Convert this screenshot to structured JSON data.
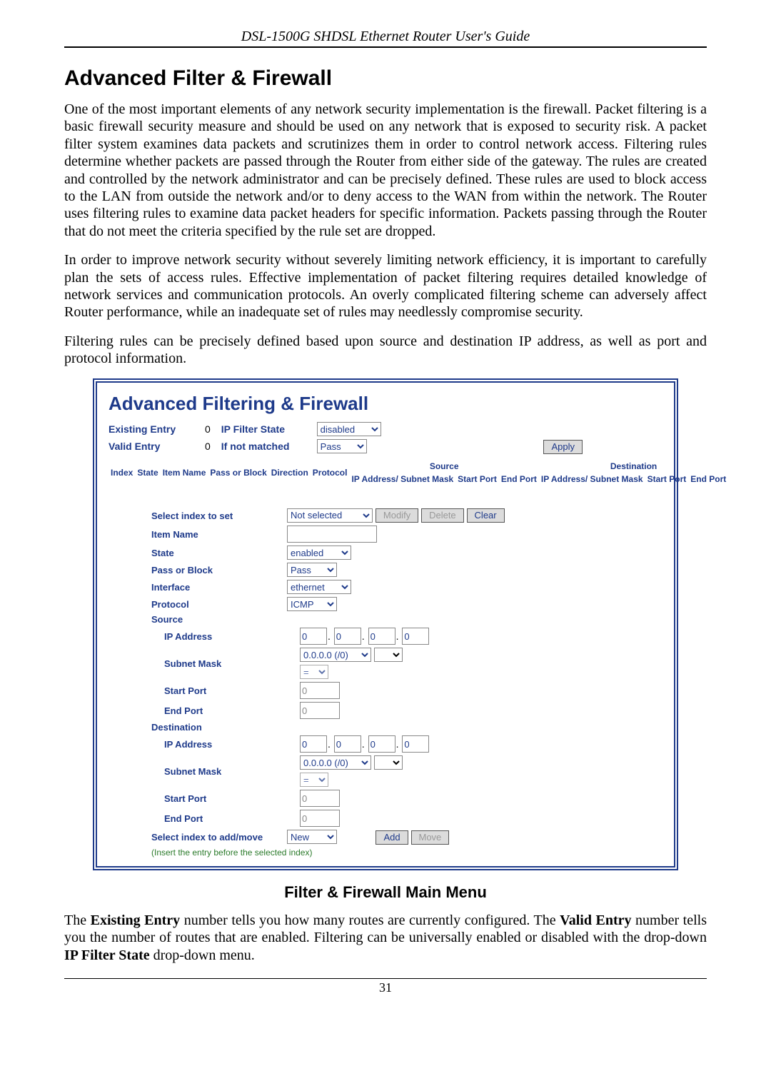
{
  "doc": {
    "running_head": "DSL-1500G SHDSL Ethernet Router User's Guide",
    "section_title": "Advanced Filter & Firewall",
    "para1": "One of the most important elements of any network security implementation is the firewall. Packet filtering is a basic firewall security measure and should be used on any network that is exposed to security risk. A packet filter system examines data packets and scrutinizes them in order to control network access. Filtering rules determine whether packets are passed through the Router from either side of the gateway. The rules are created and controlled by the network administrator and can be precisely defined. These rules are used to block access to the LAN from outside the network and/or to deny access to the WAN from within the network. The Router uses filtering rules to examine data packet headers for specific information. Packets passing through the Router that do not meet the criteria specified by the rule set are dropped.",
    "para2": "In order to improve network security without severely limiting network efficiency, it is important to carefully plan the sets of access rules. Effective implementation of packet filtering requires detailed knowledge of network services and communication protocols. An overly complicated filtering scheme can adversely affect Router performance, while an inadequate set of rules may needlessly compromise security.",
    "para3": "Filtering rules can be precisely defined based upon source and destination IP address, as well as port and protocol information.",
    "caption": "Filter & Firewall Main Menu",
    "para4_html": "The <b>Existing Entry</b> number tells you how many routes are currently configured. The <b>Valid Entry</b> number tells you the number of routes that are enabled. Filtering can be universally enabled or disabled with the drop-down <b>IP Filter State</b> drop-down menu.",
    "page_number": "31"
  },
  "panel": {
    "title": "Advanced Filtering & Firewall",
    "existing_entry_label": "Existing Entry",
    "existing_entry_value": "0",
    "ipfilter_label": "IP Filter State",
    "ipfilter_select": "disabled",
    "valid_entry_label": "Valid Entry",
    "valid_entry_value": "0",
    "ifnotmatched_label": "If not matched",
    "ifnotmatched_select": "Pass",
    "apply_btn": "Apply",
    "table_headers": {
      "source": "Source",
      "destination": "Destination",
      "c1": "Index",
      "c2": "State",
      "c3": "Item Name",
      "c4": "Pass or Block",
      "c5": "Direction",
      "c6": "Protocol",
      "c7a": "IP Address/ Subnet Mask",
      "c8a": "Start Port",
      "c9a": "End Port",
      "c7b": "IP Address/ Subnet Mask",
      "c8b": "Start Port",
      "c9b": "End Port"
    },
    "form": {
      "select_index_label": "Select index to set",
      "select_index_select": "Not selected",
      "modify_btn": "Modify",
      "delete_btn": "Delete",
      "clear_btn": "Clear",
      "item_name_label": "Item Name",
      "item_name_value": "",
      "state_label": "State",
      "state_select": "enabled",
      "passblock_label": "Pass or Block",
      "passblock_select": "Pass",
      "interface_label": "Interface",
      "interface_select": "ethernet",
      "protocol_label": "Protocol",
      "protocol_select": "ICMP",
      "source_label": "Source",
      "ipaddr_label": "IP Address",
      "subnet_label": "Subnet Mask",
      "subnet_select": "0.0.0.0 (/0)",
      "eq_select": "=",
      "startport_label": "Start Port",
      "startport_value": "0",
      "endport_label": "End Port",
      "endport_value": "0",
      "dest_label": "Destination",
      "ip_octet": "0",
      "select_add_label": "Select index to add/move",
      "select_add_select": "New",
      "add_btn": "Add",
      "move_btn": "Move",
      "insert_note": "(Insert the entry before the selected index)"
    }
  }
}
